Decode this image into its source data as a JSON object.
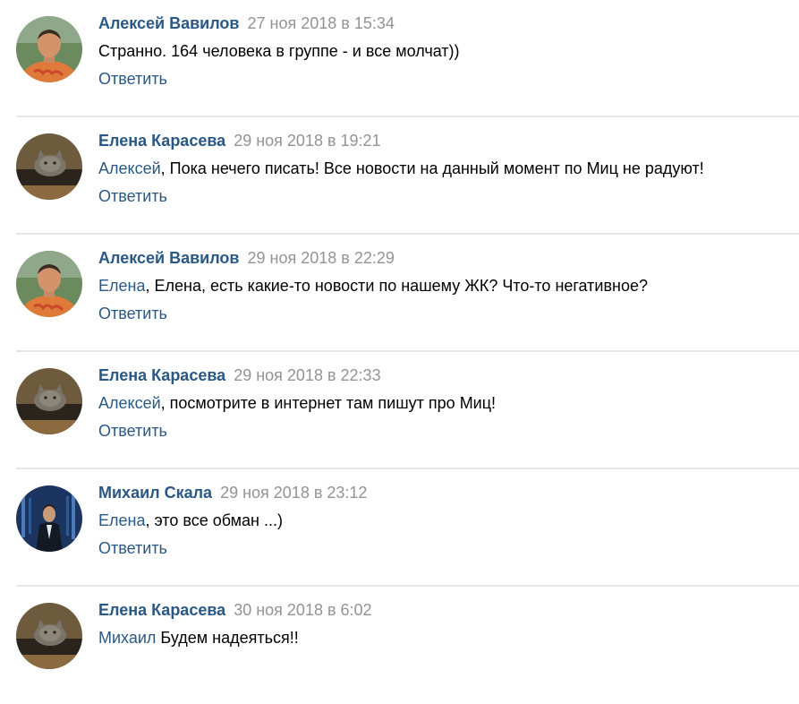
{
  "comments": [
    {
      "author": "Алексей Вавилов",
      "date": "27 ноя 2018 в 15:34",
      "mention": "",
      "text": "Странно. 164 человека в группе - и все молчат))",
      "reply": "Ответить",
      "avatar": "man-orange-shirt"
    },
    {
      "author": "Елена Карасева",
      "date": "29 ноя 2018 в 19:21",
      "mention": "Алексей",
      "text": ", Пока нечего писать! Все новости на данный момент по Миц не радуют!",
      "reply": "Ответить",
      "avatar": "cat"
    },
    {
      "author": "Алексей Вавилов",
      "date": "29 ноя 2018 в 22:29",
      "mention": "Елена",
      "text": ", Елена, есть какие-то новости по нашему ЖК? Что-то негативное?",
      "reply": "Ответить",
      "avatar": "man-orange-shirt"
    },
    {
      "author": "Елена Карасева",
      "date": "29 ноя 2018 в 22:33",
      "mention": "Алексей",
      "text": ", посмотрите в интернет там пишут про Миц!",
      "reply": "Ответить",
      "avatar": "cat"
    },
    {
      "author": "Михаил Скала",
      "date": "29 ноя 2018 в 23:12",
      "mention": "Елена",
      "text": ", это все обман ...)",
      "reply": "Ответить",
      "avatar": "man-suit"
    },
    {
      "author": "Елена Карасева",
      "date": "30 ноя 2018 в 6:02",
      "mention": "Михаил",
      "text": " Будем надеяться!!",
      "reply": "",
      "avatar": "cat"
    }
  ]
}
